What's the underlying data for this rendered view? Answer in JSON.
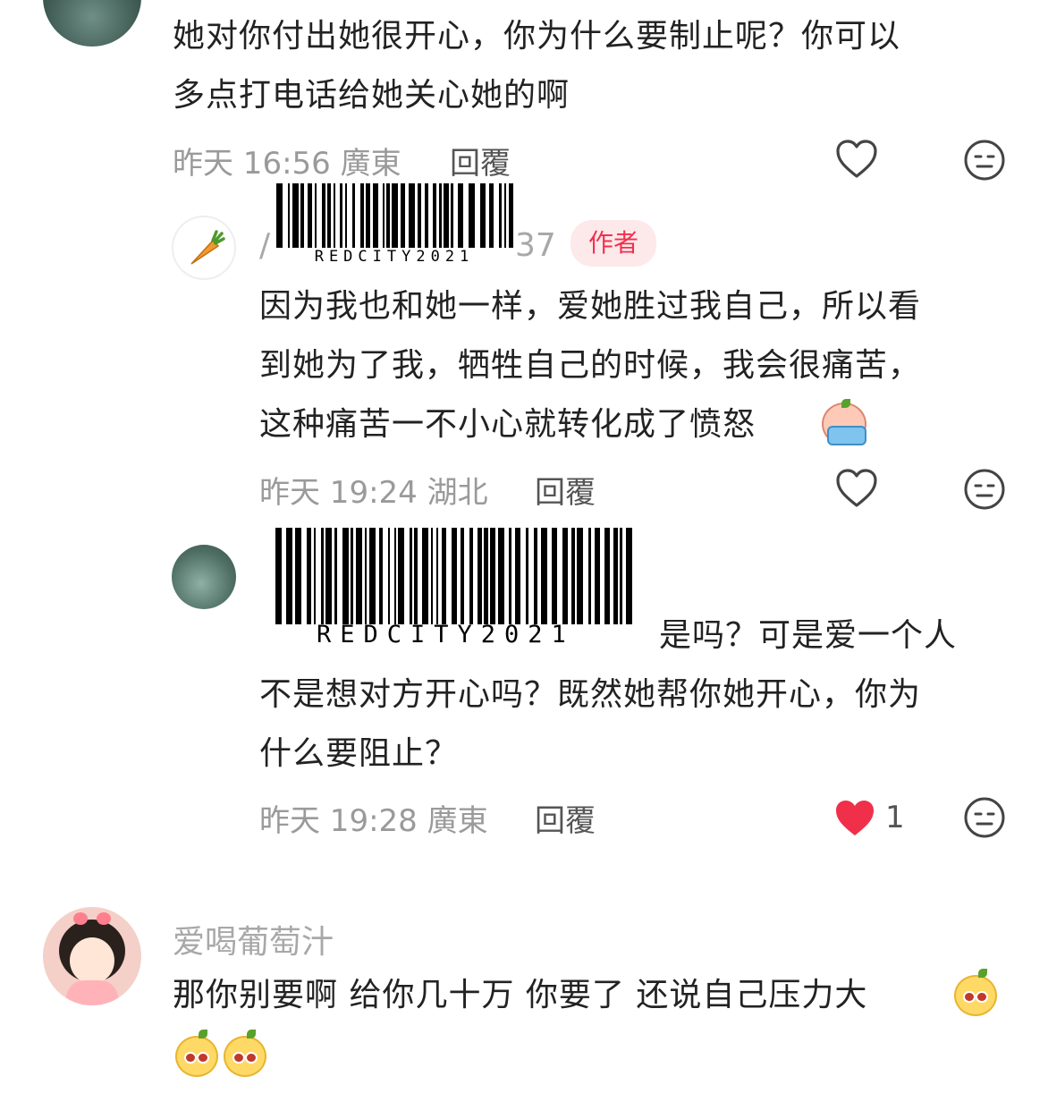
{
  "comments": [
    {
      "text_line1": "她对你付出她很开心，你为什么要制止呢？你可以",
      "text_line2": "多点打电话给她关心她的啊",
      "time": "昨天 16:56",
      "location": "廣東",
      "reply_label": "回覆"
    },
    {
      "name_visible": "/",
      "name_suffix": "37",
      "badge": "作者",
      "text_line1": "因为我也和她一样，爱她胜过我自己，所以看",
      "text_line2": "到她为了我，牺牲自己的时候，我会很痛苦，",
      "text_line3": "这种痛苦一不小心就转化成了愤怒",
      "time": "昨天 19:24",
      "location": "湖北",
      "reply_label": "回覆"
    },
    {
      "text_line1": "是吗？可是爱一个人",
      "text_line2": "不是想对方开心吗？既然她帮你她开心，你为",
      "text_line3": "什么要阻止？",
      "time": "昨天 19:28",
      "location": "廣東",
      "reply_label": "回覆",
      "like_count": "1"
    },
    {
      "name": "爱喝葡萄汁",
      "text_line1": "那你别要啊 给你几十万 你要了 还说自己压力大"
    }
  ],
  "watermark": "REDCITY2021",
  "colors": {
    "liked": "#f0304a",
    "badge_bg": "#fde8ea",
    "badge_text": "#f2304e"
  }
}
